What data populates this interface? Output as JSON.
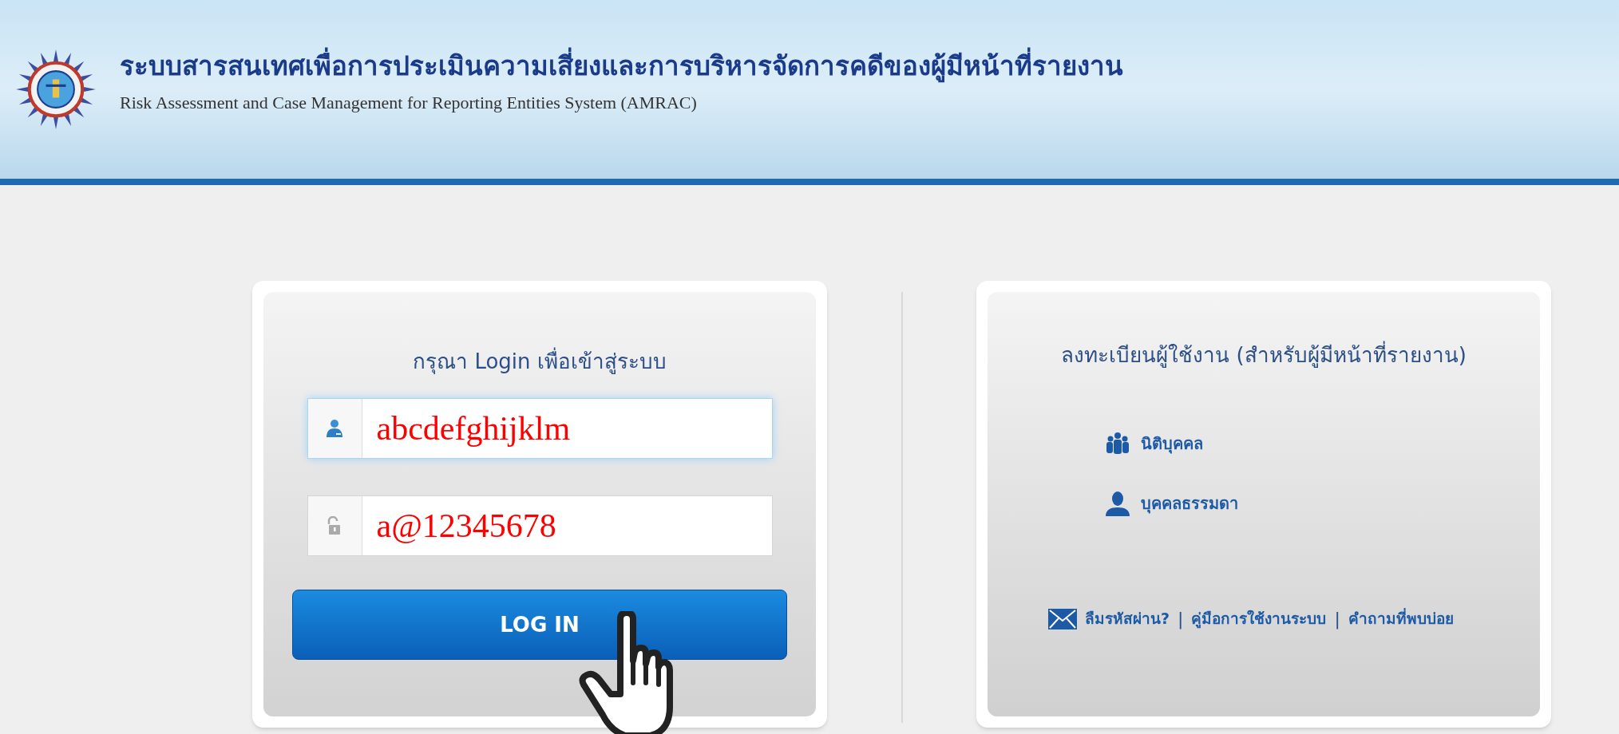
{
  "header": {
    "title": "ระบบสารสนเทศเพื่อการประเมินความเสี่ยงและการบริหารจัดการคดีของผู้มีหน้าที่รายงาน",
    "subtitle": "Risk Assessment and Case Management for Reporting Entities System (AMRAC)"
  },
  "login": {
    "title": "กรุณา Login เพื่อเข้าสู่ระบบ",
    "fields": [
      {
        "kind": "user",
        "value": "abcdefghijklm",
        "focused": true
      },
      {
        "kind": "password",
        "value": "a@12345678",
        "focused": false
      }
    ],
    "button": "LOG IN"
  },
  "register": {
    "title": "ลงทะเบียนผู้ใช้งาน (สำหรับผู้มีหน้าที่รายงาน)",
    "options": [
      {
        "kind": "group",
        "label": "นิติบุคคล"
      },
      {
        "kind": "person",
        "label": "บุคคลธรรมดา"
      }
    ],
    "links": [
      {
        "kind": "link",
        "text": "ลืมรหัสผ่าน?"
      },
      {
        "kind": "separator",
        "text": "|"
      },
      {
        "kind": "link",
        "text": "คู่มือการใช้งานระบบ"
      },
      {
        "kind": "separator",
        "text": "|"
      },
      {
        "kind": "link",
        "text": "คำถามที่พบบ่อย"
      }
    ]
  }
}
